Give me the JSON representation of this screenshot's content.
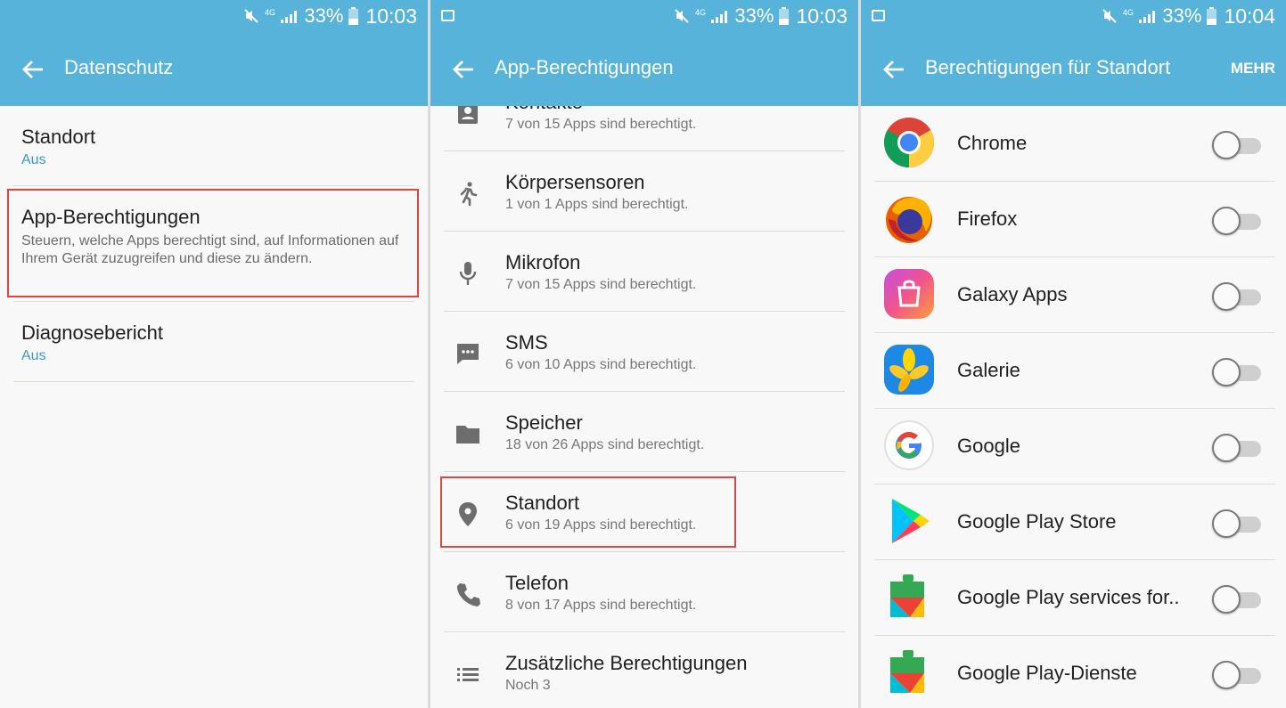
{
  "status": {
    "battery_pct": "33%",
    "network": "4G",
    "panels": [
      {
        "time": "10:03"
      },
      {
        "time": "10:03"
      },
      {
        "time": "10:04"
      }
    ]
  },
  "panel1": {
    "title": "Datenschutz",
    "items": [
      {
        "title": "Standort",
        "subtitle": "Aus"
      },
      {
        "title": "App-Berechtigungen",
        "description": "Steuern, welche Apps berechtigt sind, auf Informationen auf Ihrem Gerät zuzugreifen und diese zu ändern."
      },
      {
        "title": "Diagnosebericht",
        "subtitle": "Aus"
      }
    ]
  },
  "panel2": {
    "title": "App-Berechtigungen",
    "items": [
      {
        "title": "Kontakte",
        "subtitle": "7 von 15 Apps sind berechtigt.",
        "icon": "contacts-icon"
      },
      {
        "title": "Körpersensoren",
        "subtitle": "1 von 1 Apps sind berechtigt.",
        "icon": "body-sensors-icon"
      },
      {
        "title": "Mikrofon",
        "subtitle": "7 von 15 Apps sind berechtigt.",
        "icon": "microphone-icon"
      },
      {
        "title": "SMS",
        "subtitle": "6 von 10 Apps sind berechtigt.",
        "icon": "sms-icon"
      },
      {
        "title": "Speicher",
        "subtitle": "18 von 26 Apps sind berechtigt.",
        "icon": "folder-icon"
      },
      {
        "title": "Standort",
        "subtitle": "6 von 19 Apps sind berechtigt.",
        "icon": "location-pin-icon"
      },
      {
        "title": "Telefon",
        "subtitle": "8 von 17 Apps sind berechtigt.",
        "icon": "phone-icon"
      },
      {
        "title": "Zusätzliche Berechtigungen",
        "subtitle": "Noch 3",
        "icon": "list-icon"
      }
    ]
  },
  "panel3": {
    "title": "Berechtigungen für Standort",
    "more_label": "MEHR",
    "apps": [
      {
        "name": "Chrome",
        "enabled": false,
        "icon": "chrome-icon"
      },
      {
        "name": "Firefox",
        "enabled": false,
        "icon": "firefox-icon"
      },
      {
        "name": "Galaxy Apps",
        "enabled": false,
        "icon": "galaxy-apps-icon"
      },
      {
        "name": "Galerie",
        "enabled": false,
        "icon": "gallery-icon"
      },
      {
        "name": "Google",
        "enabled": false,
        "icon": "google-icon"
      },
      {
        "name": "Google Play Store",
        "enabled": false,
        "icon": "play-store-icon"
      },
      {
        "name": "Google Play services for..",
        "enabled": false,
        "icon": "play-services-icon"
      },
      {
        "name": "Google Play-Dienste",
        "enabled": false,
        "icon": "play-services-icon"
      }
    ]
  },
  "colors": {
    "app_bar": "#57b3d9",
    "accent_text": "#3c98c8",
    "highlight_border": "#e04545",
    "background": "#f8f8f8"
  }
}
